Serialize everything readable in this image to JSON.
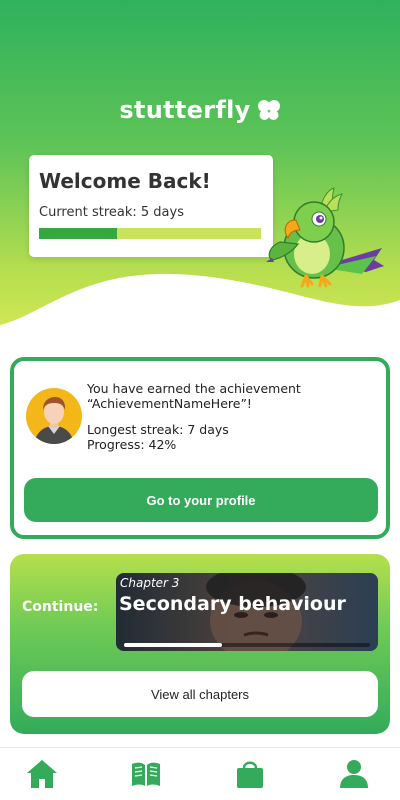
{
  "header": {
    "app_name": "stutterfly",
    "logo_icon": "butterfly-icon"
  },
  "welcome": {
    "title": "Welcome Back!",
    "streak_text": "Current streak: 5 days",
    "streak_progress": 0.35
  },
  "mascot": {
    "icon": "parrot-mascot"
  },
  "achievement": {
    "line1": "You have earned the achievement",
    "line2": "“AchievementNameHere”!",
    "longest_streak": "Longest streak: 7 days",
    "progress_text": "Progress: 42%",
    "button_label": "Go to your profile"
  },
  "continue": {
    "label": "Continue:",
    "chapter_number": "Chapter 3",
    "chapter_title": "Secondary behaviour",
    "chapter_progress": 0.4,
    "view_all_label": "View all chapters"
  },
  "nav": {
    "items": [
      {
        "icon": "home-icon"
      },
      {
        "icon": "book-icon"
      },
      {
        "icon": "shopping-bag-icon"
      },
      {
        "icon": "user-icon"
      }
    ],
    "color": "#33ab5a"
  },
  "colors": {
    "primary_green": "#33ab5a",
    "lime": "#c9e35a"
  }
}
